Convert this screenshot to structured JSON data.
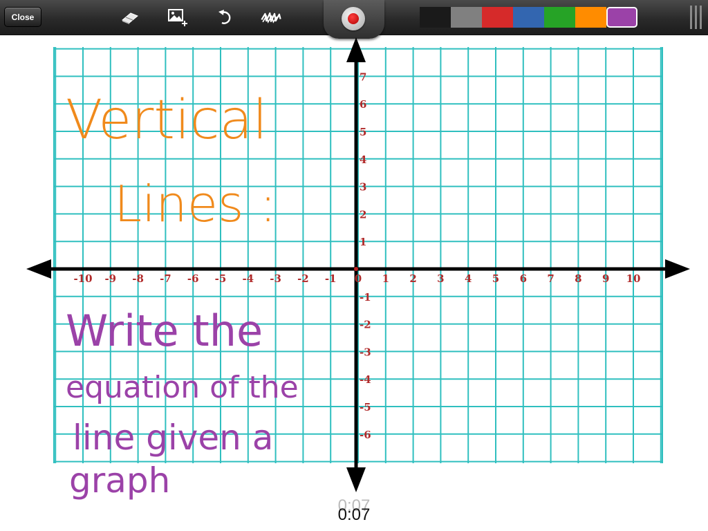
{
  "toolbar": {
    "close_label": "Close",
    "tools": [
      {
        "name": "eraser-icon"
      },
      {
        "name": "add-image-icon"
      },
      {
        "name": "undo-icon"
      },
      {
        "name": "clear-scribble-icon"
      }
    ],
    "record_icon": "record-icon",
    "colors": [
      "#1a1a1a",
      "#808080",
      "#d62a2a",
      "#3366b0",
      "#26a326",
      "#ff8c00",
      "#9b42a8"
    ],
    "selected_color_index": 6
  },
  "graph": {
    "grid_color": "#2fbfbf",
    "axis_color": "#000000",
    "tick_color": "#b02a2a",
    "x_ticks": [
      "-10",
      "-9",
      "-8",
      "-7",
      "-6",
      "-5",
      "-4",
      "-3",
      "-2",
      "-1",
      "0",
      "1",
      "2",
      "3",
      "4",
      "5",
      "6",
      "7",
      "8",
      "9",
      "10"
    ],
    "y_ticks_positive": [
      "7",
      "6",
      "5",
      "4",
      "3",
      "2",
      "1"
    ],
    "y_ticks_negative": [
      "-1",
      "-2",
      "-3",
      "-4",
      "-5",
      "-6"
    ]
  },
  "handwriting": {
    "title_color": "#f08a1c",
    "title_lines": [
      "Vertical",
      "Lines :"
    ],
    "prompt_color": "#9b42a8",
    "prompt_lines": [
      "Write the",
      "equation of the",
      "line given a",
      "graph"
    ]
  },
  "timer": {
    "ghost": "0:07",
    "value": "0:07"
  }
}
